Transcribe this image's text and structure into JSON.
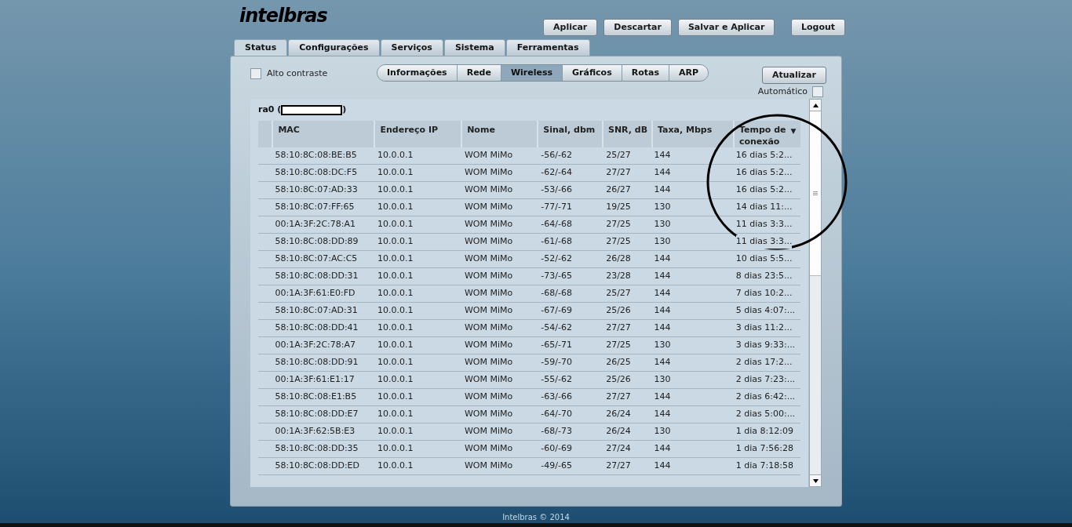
{
  "logo": "intelbras",
  "top_buttons": [
    "Aplicar",
    "Descartar",
    "Salvar e Aplicar"
  ],
  "logout": "Logout",
  "tabs": [
    {
      "label": "Status",
      "selected": true
    },
    {
      "label": "Configurações",
      "selected": false
    },
    {
      "label": "Serviços",
      "selected": false
    },
    {
      "label": "Sistema",
      "selected": false
    },
    {
      "label": "Ferramentas",
      "selected": false
    }
  ],
  "high_contrast": {
    "label": "Alto contraste",
    "checked": false
  },
  "subtabs": [
    {
      "label": "Informações",
      "selected": false
    },
    {
      "label": "Rede",
      "selected": false
    },
    {
      "label": "Wireless",
      "selected": true
    },
    {
      "label": "Gráficos",
      "selected": false
    },
    {
      "label": "Rotas",
      "selected": false
    },
    {
      "label": "ARP",
      "selected": false
    }
  ],
  "refresh_button": "Atualizar",
  "automatic": {
    "label": "Automático",
    "checked": false
  },
  "interface": {
    "prefix": "ra0 (",
    "suffix": ")"
  },
  "table": {
    "columns": [
      "MAC",
      "Endereço IP",
      "Nome",
      "Sinal, dbm",
      "SNR, dB",
      "Taxa, Mbps",
      "Tempo de conexão"
    ],
    "sort_indicator": "▼",
    "rows": [
      [
        "58:10:8C:08:BE:B5",
        "10.0.0.1",
        "WOM MiMo",
        "-56/-62",
        "25/27",
        "144",
        "16 dias 5:2..."
      ],
      [
        "58:10:8C:08:DC:F5",
        "10.0.0.1",
        "WOM MiMo",
        "-62/-64",
        "27/27",
        "144",
        "16 dias 5:2..."
      ],
      [
        "58:10:8C:07:AD:33",
        "10.0.0.1",
        "WOM MiMo",
        "-53/-66",
        "26/27",
        "144",
        "16 dias 5:2..."
      ],
      [
        "58:10:8C:07:FF:65",
        "10.0.0.1",
        "WOM MiMo",
        "-77/-71",
        "19/25",
        "130",
        "14 dias 11:..."
      ],
      [
        "00:1A:3F:2C:78:A1",
        "10.0.0.1",
        "WOM MiMo",
        "-64/-68",
        "27/25",
        "130",
        "11 dias 3:3..."
      ],
      [
        "58:10:8C:08:DD:89",
        "10.0.0.1",
        "WOM MiMo",
        "-61/-68",
        "27/25",
        "130",
        "11 dias 3:3..."
      ],
      [
        "58:10:8C:07:AC:C5",
        "10.0.0.1",
        "WOM MiMo",
        "-52/-62",
        "26/28",
        "144",
        "10 dias 5:5..."
      ],
      [
        "58:10:8C:08:DD:31",
        "10.0.0.1",
        "WOM MiMo",
        "-73/-65",
        "23/28",
        "144",
        "8 dias 23:5..."
      ],
      [
        "00:1A:3F:61:E0:FD",
        "10.0.0.1",
        "WOM MiMo",
        "-68/-68",
        "25/27",
        "144",
        "7 dias 10:2..."
      ],
      [
        "58:10:8C:07:AD:31",
        "10.0.0.1",
        "WOM MiMo",
        "-67/-69",
        "25/26",
        "144",
        "5 dias 4:07:..."
      ],
      [
        "58:10:8C:08:DD:41",
        "10.0.0.1",
        "WOM MiMo",
        "-54/-62",
        "27/27",
        "144",
        "3 dias 11:2..."
      ],
      [
        "00:1A:3F:2C:78:A7",
        "10.0.0.1",
        "WOM MiMo",
        "-65/-71",
        "27/25",
        "130",
        "3 dias 9:33:..."
      ],
      [
        "58:10:8C:08:DD:91",
        "10.0.0.1",
        "WOM MiMo",
        "-59/-70",
        "26/25",
        "144",
        "2 dias 17:2..."
      ],
      [
        "00:1A:3F:61:E1:17",
        "10.0.0.1",
        "WOM MiMo",
        "-55/-62",
        "25/26",
        "130",
        "2 dias 7:23:..."
      ],
      [
        "58:10:8C:08:E1:B5",
        "10.0.0.1",
        "WOM MiMo",
        "-63/-66",
        "27/27",
        "144",
        "2 dias 6:42:..."
      ],
      [
        "58:10:8C:08:DD:E7",
        "10.0.0.1",
        "WOM MiMo",
        "-64/-70",
        "26/24",
        "144",
        "2 dias 5:00:..."
      ],
      [
        "00:1A:3F:62:5B:E3",
        "10.0.0.1",
        "WOM MiMo",
        "-68/-73",
        "26/24",
        "130",
        "1 dia 8:12:09"
      ],
      [
        "58:10:8C:08:DD:35",
        "10.0.0.1",
        "WOM MiMo",
        "-60/-69",
        "27/24",
        "144",
        "1 dia 7:56:28"
      ],
      [
        "58:10:8C:08:DD:ED",
        "10.0.0.1",
        "WOM MiMo",
        "-49/-65",
        "27/27",
        "144",
        "1 dia 7:18:58"
      ]
    ]
  },
  "footer": "Intelbras © 2014"
}
